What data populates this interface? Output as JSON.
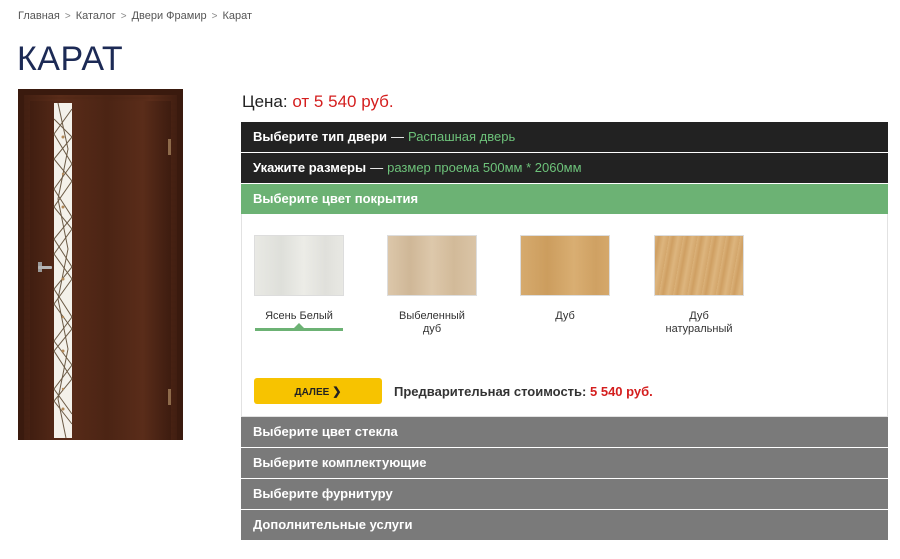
{
  "breadcrumb": [
    "Главная",
    "Каталог",
    "Двери Фрамир",
    "Карат"
  ],
  "page_title": "КАРАТ",
  "price": {
    "label": "Цена:",
    "value": "от 5 540 руб."
  },
  "steps": {
    "door_type": {
      "label": "Выберите тип двери",
      "value": "Распашная дверь"
    },
    "sizes": {
      "label": "Укажите размеры",
      "value": "размер проема 500мм * 2060мм"
    },
    "color": {
      "label": "Выберите цвет покрытия"
    },
    "glass": {
      "label": "Выберите цвет стекла"
    },
    "components": {
      "label": "Выберите комплектующие"
    },
    "hardware": {
      "label": "Выберите фурнитуру"
    },
    "services": {
      "label": "Дополнительные услуги"
    }
  },
  "swatches": [
    {
      "name": "Ясень Белый",
      "color": "#e6e6e1",
      "selected": true
    },
    {
      "name": "Выбеленный дуб",
      "color": "#d8c3a5",
      "selected": false
    },
    {
      "name": "Дуб",
      "color": "#d4a86a",
      "selected": false
    },
    {
      "name": "Дуб натуральный",
      "color": "#d7ad74",
      "selected": false
    }
  ],
  "next_button": {
    "label": "ДАЛЕЕ",
    "icon": "chevron-right-icon",
    "color": "#f7c300"
  },
  "estimate": {
    "label": "Предварительная стоимость:",
    "value": "5 540 руб."
  },
  "colors": {
    "accent_green": "#6cb274",
    "price_red": "#d41e1e",
    "dark_bar": "#222222",
    "grey_bar": "#7a7a7a",
    "door_wood": "#4a2516"
  }
}
